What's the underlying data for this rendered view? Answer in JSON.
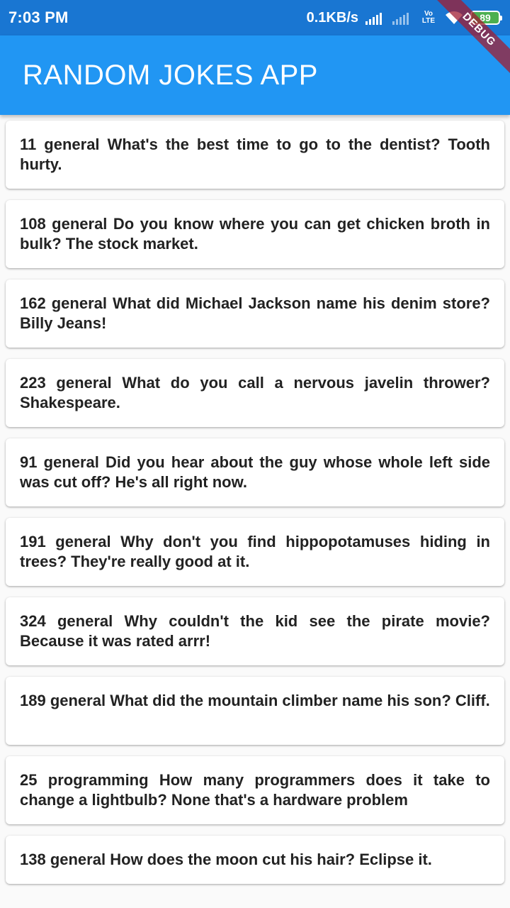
{
  "status_bar": {
    "time": "7:03 PM",
    "net_speed": "0.1KB/s",
    "volte_top": "Vo",
    "volte_bottom": "LTE",
    "battery": "89",
    "icons": [
      "signal-icon",
      "signal-icon",
      "volte-icon",
      "wifi-icon",
      "battery-icon"
    ]
  },
  "app_bar": {
    "title": "RANDOM JOKES APP"
  },
  "debug_banner": "DEBUG",
  "jokes": [
    {
      "text": "11 general What's the best time to go to the dentist? Tooth hurty."
    },
    {
      "text": "108 general Do you know where you can get chicken broth in bulk? The stock market."
    },
    {
      "text": "162 general What did Michael Jackson name his denim store?    Billy Jeans!"
    },
    {
      "text": "223 general What do you call a nervous javelin thrower? Shakespeare."
    },
    {
      "text": "91 general Did you hear about the guy whose whole left side was cut off? He's all right now."
    },
    {
      "text": "191 general Why don't you find hippopotamuses hiding in trees? They're really good at it."
    },
    {
      "text": "324 general Why couldn't the kid see the pirate movie? Because it was rated arrr!"
    },
    {
      "text": "189 general What did the mountain climber name his son? Cliff."
    },
    {
      "text": "25 programming How many programmers does it take to change a lightbulb? None that's a hardware problem"
    },
    {
      "text": "138 general How does the moon cut his hair? Eclipse it."
    }
  ],
  "colors": {
    "status_bar": "#1976d2",
    "app_bar": "#2196f3",
    "background": "#fafafa",
    "card": "#ffffff",
    "debug": "#a01e32",
    "battery": "#4caf50"
  }
}
